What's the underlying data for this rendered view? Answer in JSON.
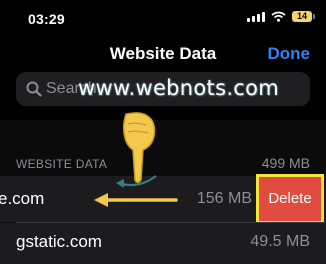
{
  "status_bar": {
    "time": "03:29",
    "battery": "14"
  },
  "nav": {
    "title": "Website Data",
    "done": "Done"
  },
  "search": {
    "placeholder": "Search"
  },
  "watermark": "www.webnots.com",
  "section": {
    "header": "WEBSITE DATA",
    "total": "499 MB"
  },
  "rows": [
    {
      "name": "e.com",
      "size": "156 MB",
      "action": "Delete"
    },
    {
      "name": "gstatic.com",
      "size": "49.5 MB"
    }
  ],
  "colors": {
    "accent": "#2d83f5",
    "delete": "#e04c3f",
    "highlight": "#f2e43a",
    "battery": "#f3d36b",
    "hand": "#f2c94c"
  },
  "icons": [
    "signal-icon",
    "wifi-icon",
    "battery-icon",
    "search-icon",
    "swipe-arrow-icon",
    "curved-arrow-icon",
    "pointing-hand-icon"
  ]
}
